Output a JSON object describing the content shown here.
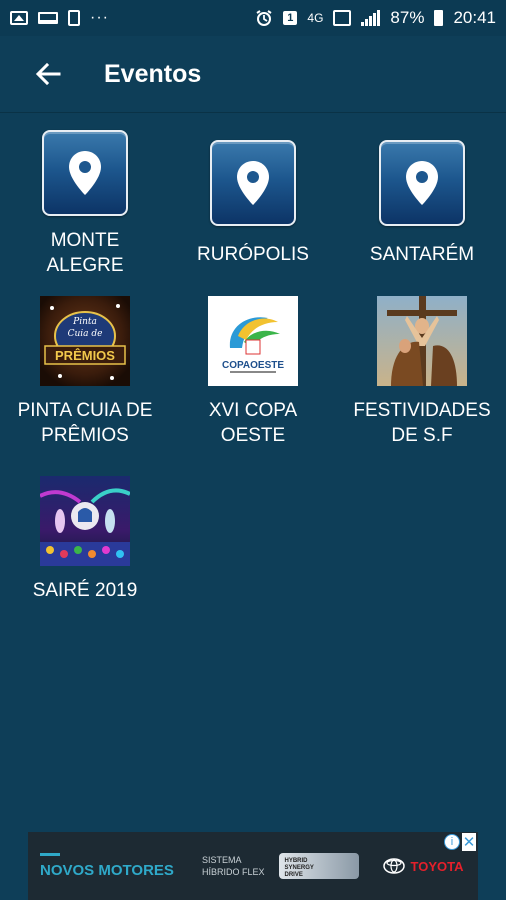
{
  "status_bar": {
    "network_label": "4G",
    "sim_badge": "1",
    "battery_percent": "87%",
    "time": "20:41",
    "more_glyph": "···"
  },
  "app_bar": {
    "title": "Eventos",
    "back_icon": "arrow-left-icon"
  },
  "events": [
    {
      "label": "MONTE\nALEGRE",
      "icon": "location-pin-icon"
    },
    {
      "label": "RURÓPOLIS",
      "icon": "location-pin-icon"
    },
    {
      "label": "SANTARÉM",
      "icon": "location-pin-icon"
    },
    {
      "label": "PINTA CUIA DE\nPRÊMIOS",
      "image": "pinta-cuia-thumbnail",
      "thumb_text": [
        "Pinta",
        "Cuia de",
        "PRÊMIOS"
      ]
    },
    {
      "label": "XVI COPA\nOESTE",
      "image": "copa-oeste-thumbnail",
      "thumb_text": "COPAOESTE"
    },
    {
      "label": "FESTIVIDADES\nDE S.F",
      "image": "festividades-thumbnail"
    },
    {
      "label": "SAIRÉ 2019",
      "image": "saire-thumbnail"
    }
  ],
  "ad": {
    "headline": "NOVOS MOTORES",
    "sub_line1": "SISTEMA",
    "sub_line2": "HÍBRIDO FLEX",
    "battery_text": [
      "HYBRID",
      "SYNERGY",
      "DRIVE"
    ],
    "brand": "TOYOTA",
    "info_glyph": "i",
    "close_glyph": "✕"
  },
  "colors": {
    "background": "#0e3e58",
    "pin_box_top": "#3a79ac",
    "pin_box_bottom": "#0c3466",
    "ad_accent": "#2fa9c9",
    "brand_red": "#e5202b"
  }
}
